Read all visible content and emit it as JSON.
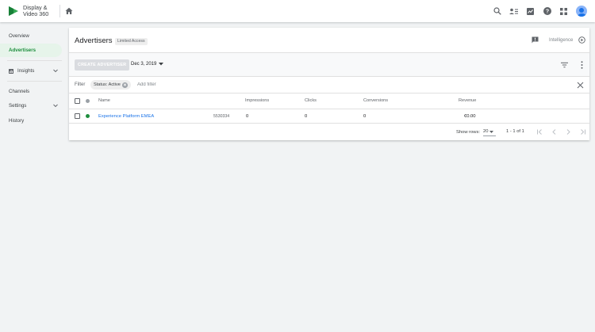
{
  "app": {
    "brand_line1": "Display &",
    "brand_line2": "Video 360"
  },
  "colors": {
    "accent_green": "#1e8e3e",
    "link_blue": "#1a73e8",
    "active_nav_bg": "#e6f4ea"
  },
  "topbar": {
    "icons": [
      "search-icon",
      "account-list-icon",
      "reports-icon",
      "help-icon",
      "apps-grid-icon",
      "account-avatar"
    ]
  },
  "sidebar": {
    "items": [
      {
        "label": "Overview"
      },
      {
        "label": "Advertisers",
        "active": true
      },
      {
        "label": "Insights"
      },
      {
        "label": "Channels"
      },
      {
        "label": "Settings"
      },
      {
        "label": "History"
      }
    ]
  },
  "header": {
    "title": "Advertisers",
    "access_badge": "Limited Access",
    "intelligence_label": "Intelligence"
  },
  "toolbar": {
    "create_label": "CREATE ADVERTISER",
    "date": "Dec 3, 2019"
  },
  "filters": {
    "label": "Filter",
    "chip": "Status: Active",
    "add_placeholder": "Add filter"
  },
  "table": {
    "columns": [
      "Name",
      "Impressions",
      "Clicks",
      "Conversions",
      "Revenue"
    ],
    "rows": [
      {
        "status": "active",
        "name": "Experience Platform EMEA",
        "id": "5530334",
        "impressions": "0",
        "clicks": "0",
        "conversions": "0",
        "revenue": "€0.00"
      }
    ]
  },
  "pagination": {
    "rows_label": "Show rows:",
    "rows_value": "20",
    "range": "1 - 1 of 1"
  }
}
